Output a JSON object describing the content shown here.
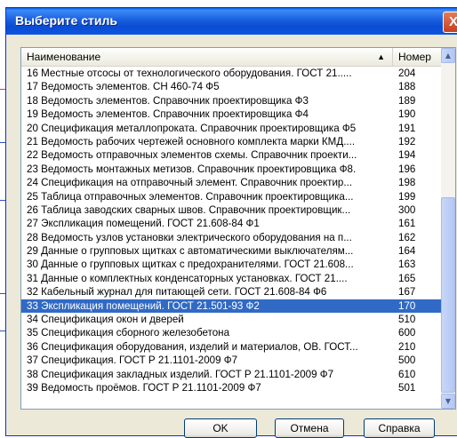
{
  "dialog": {
    "title": "Выберите стиль",
    "close_label": "X"
  },
  "list": {
    "columns": {
      "name": "Наименование",
      "number": "Номер"
    },
    "sort_indicator": "▲",
    "selected_index": 17,
    "rows": [
      {
        "name": "16 Местные отсосы от технологического оборудования. ГОСТ 21.....",
        "number": "204"
      },
      {
        "name": "17 Ведомость элементов. СН 460-74 Ф5",
        "number": "188"
      },
      {
        "name": "18 Ведомость элементов. Справочник проектировщика Ф3",
        "number": "189"
      },
      {
        "name": "19 Ведомость элементов. Справочник проектировщика Ф4",
        "number": "190"
      },
      {
        "name": "20 Спецификация металлопроката. Справочник проектировщика Ф5",
        "number": "191"
      },
      {
        "name": "21 Ведомость рабочих чертежей основного комплекта марки КМД....",
        "number": "192"
      },
      {
        "name": "22 Ведомость отправочных элементов схемы. Справочник проекти...",
        "number": "194"
      },
      {
        "name": "23 Ведомость монтажных метизов. Справочник проектировщика Ф8.",
        "number": "196"
      },
      {
        "name": "24 Спецификация на отправочный элемент. Справочник проектир...",
        "number": "198"
      },
      {
        "name": "25 Таблица отправочных элементов. Справочник проектировщика...",
        "number": "199"
      },
      {
        "name": "26 Таблица заводских сварных швов. Справочник проектировщик...",
        "number": "300"
      },
      {
        "name": "27 Экспликация помещений. ГОСТ 21.608-84 Ф1",
        "number": "161"
      },
      {
        "name": "28 Ведомость узлов установки электрического оборудования на п...",
        "number": "162"
      },
      {
        "name": "29 Данные о групповых щитках с автоматическими выключателям...",
        "number": "164"
      },
      {
        "name": "30 Данные о групповых щитках с предохранителями. ГОСТ 21.608...",
        "number": "163"
      },
      {
        "name": "31 Данные о комплектных конденсаторных установках. ГОСТ 21....",
        "number": "165"
      },
      {
        "name": "32 Кабельный журнал для питающей сети. ГОСТ 21.608-84 Ф6",
        "number": "167"
      },
      {
        "name": "33 Экспликация помещений. ГОСТ 21.501-93 Ф2",
        "number": "170"
      },
      {
        "name": "34 Спецификация окон и дверей",
        "number": "510"
      },
      {
        "name": "35 Спецификация сборного железобетона",
        "number": "600"
      },
      {
        "name": "36 Спецификация оборудования, изделий и материалов, ОВ. ГОСТ...",
        "number": "210"
      },
      {
        "name": "37 Спецификация. ГОСТ Р 21.1101-2009 Ф7",
        "number": "500"
      },
      {
        "name": "38 Спецификация закладных изделий. ГОСТ Р 21.1101-2009 Ф7",
        "number": "610"
      },
      {
        "name": "39 Ведомость проёмов. ГОСТ Р 21.1101-2009 Ф7",
        "number": "501"
      }
    ]
  },
  "buttons": {
    "ok": "OK",
    "cancel": "Отмена",
    "help": "Справка"
  },
  "colors": {
    "titlebar": "#0b4bd1",
    "selection": "#316ac5",
    "dialog_bg": "#ece9d8"
  }
}
